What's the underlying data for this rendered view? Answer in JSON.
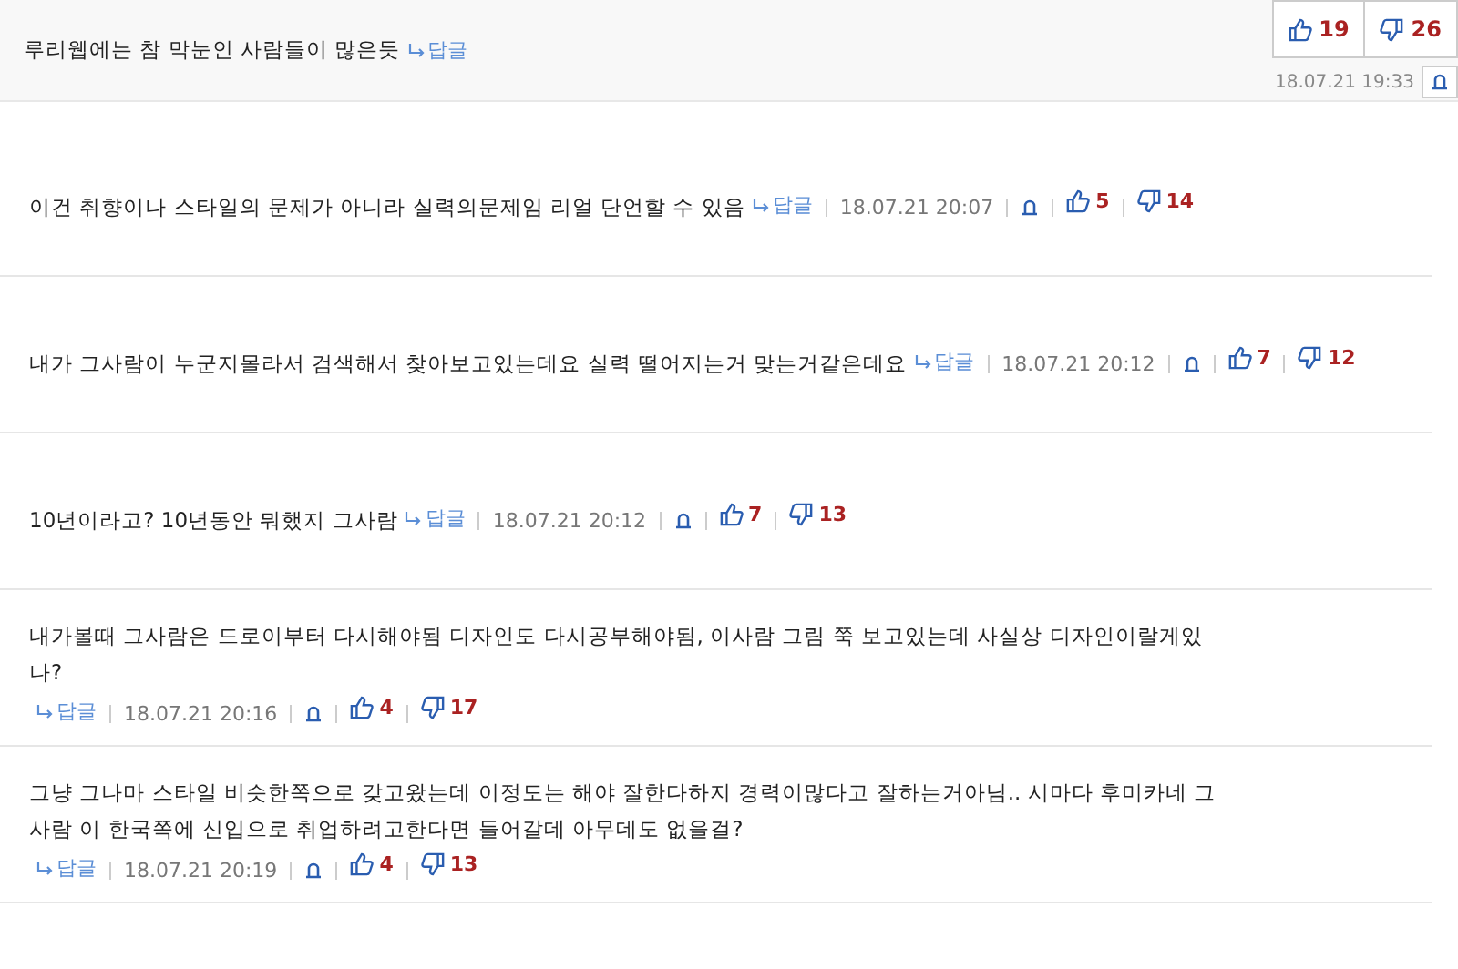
{
  "comments": [
    {
      "kind": "best",
      "text": "루리웹에는 참 막눈인 사람들이 많은듯",
      "reply": "답글",
      "date": "18.07.21 19:33",
      "likes": "19",
      "dislikes": "26"
    },
    {
      "kind": "normal",
      "text": "이건 취향이나 스타일의 문제가 아니라 실력의문제임 리얼 단언할 수 있음",
      "reply": "답글",
      "date": "18.07.21 20:07",
      "likes": "5",
      "dislikes": "14"
    },
    {
      "kind": "normal",
      "text": "내가 그사람이 누군지몰라서 검색해서 찾아보고있는데요 실력 떨어지는거 맞는거같은데요",
      "reply": "답글",
      "date": "18.07.21 20:12",
      "likes": "7",
      "dislikes": "12"
    },
    {
      "kind": "normal",
      "text": "10년이라고? 10년동안 뭐했지 그사람",
      "reply": "답글",
      "date": "18.07.21 20:12",
      "likes": "7",
      "dislikes": "13"
    },
    {
      "kind": "normal",
      "text": "내가볼때 그사람은 드로이부터 다시해야됨 디자인도 다시공부해야됨, 이사람 그림 쭉 보고있는데 사실상 디자인이랄게있나?",
      "reply": "답글",
      "date": "18.07.21 20:16",
      "likes": "4",
      "dislikes": "17"
    },
    {
      "kind": "normal",
      "text": "그냥 그나마 스타일 비슷한쪽으로 갖고왔는데 이정도는 해야 잘한다하지 경력이많다고 잘하는거아님.. 시마다 후미카네 그사람 이 한국쪽에 신입으로 취업하려고한다면 들어갈데 아무데도 없을걸?",
      "reply": "답글",
      "date": "18.07.21 20:19",
      "likes": "4",
      "dislikes": "13"
    }
  ]
}
